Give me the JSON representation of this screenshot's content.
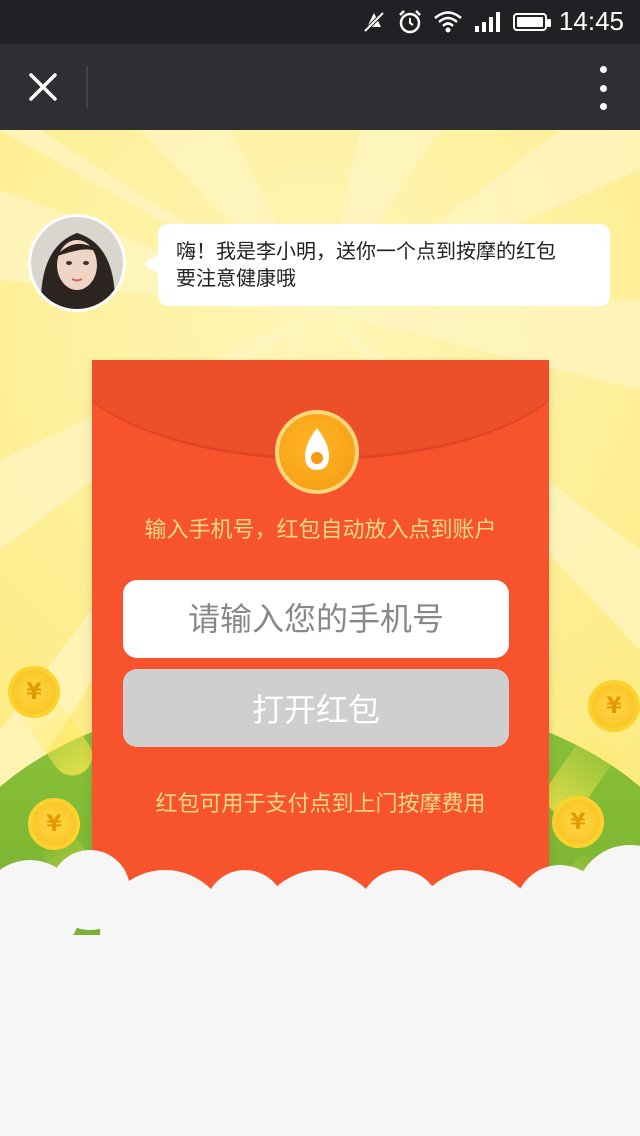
{
  "status_bar": {
    "time": "14:45",
    "icons": [
      "mute-icon",
      "alarm-icon",
      "wifi-icon",
      "signal-icon",
      "battery-icon"
    ]
  },
  "title_bar": {
    "close_icon": "close-icon",
    "menu_icon": "more-vertical-icon"
  },
  "greeting": {
    "line1": "嗨！我是李小明，送你一个点到按摩的红包",
    "line2": "要注意健康哦"
  },
  "envelope": {
    "hint": "输入手机号，红包自动放入点到账户",
    "phone_placeholder": "请输入您的手机号",
    "open_button": "打开红包",
    "footer_note": "红包可用于支付点到上门按摩费用"
  },
  "colors": {
    "envelope_red": "#f7532c",
    "accent_text": "#ffd98a",
    "button_disabled": "#cfcfcf",
    "status_bar_bg": "#1f2124",
    "title_bar_bg": "#2d2f33"
  },
  "coin_icon": "yen-coin-icon",
  "coin_symbol": "¥"
}
